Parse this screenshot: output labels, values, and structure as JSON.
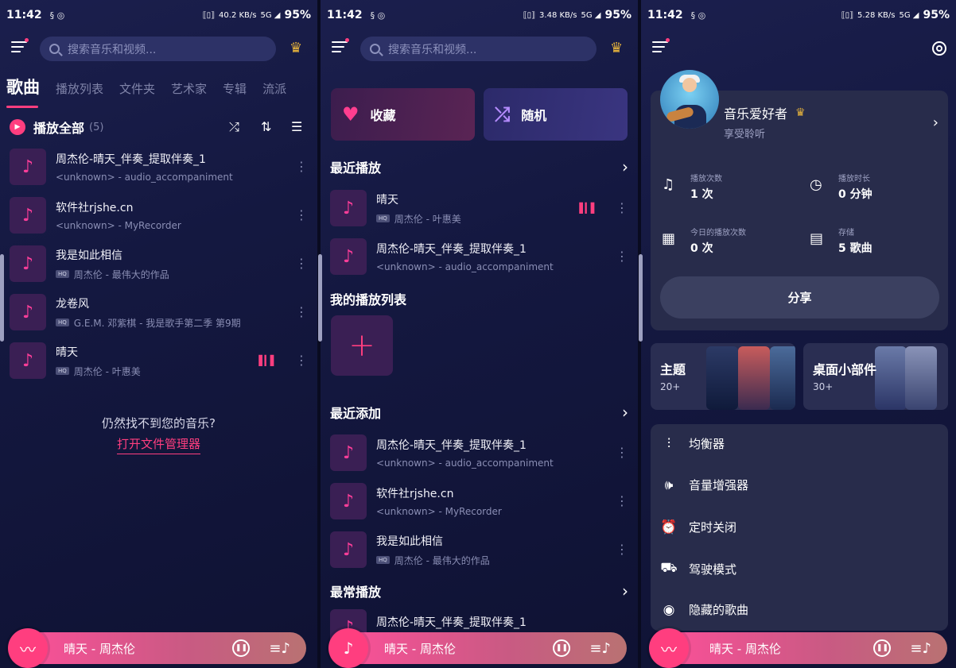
{
  "status_bars": [
    {
      "time": "11:42",
      "net": "40.2 KB/s",
      "battery": "95%"
    },
    {
      "time": "11:42",
      "net": "3.48 KB/s",
      "battery": "95%"
    },
    {
      "time": "11:42",
      "net": "5.28 KB/s",
      "battery": "95%"
    }
  ],
  "search_placeholder": "搜索音乐和视频...",
  "songs_screen": {
    "tabs": [
      "歌曲",
      "播放列表",
      "文件夹",
      "艺术家",
      "专辑",
      "流派"
    ],
    "play_all_label": "播放全部",
    "play_all_count": "(5)",
    "songs": [
      {
        "title": "周杰伦-晴天_伴奏_提取伴奏_1",
        "subtitle": "<unknown> - audio_accompaniment",
        "hq": false,
        "playing": false
      },
      {
        "title": "软件社rjshe.cn",
        "subtitle": "<unknown> - MyRecorder",
        "hq": false,
        "playing": false
      },
      {
        "title": "我是如此相信",
        "subtitle": "周杰伦 - 最伟大的作品",
        "hq": true,
        "playing": false
      },
      {
        "title": "龙卷风",
        "subtitle": "G.E.M. 邓紫棋 - 我是歌手第二季 第9期",
        "hq": true,
        "playing": false
      },
      {
        "title": "晴天",
        "subtitle": "周杰伦 - 叶惠美",
        "hq": true,
        "playing": true
      }
    ],
    "not_found_text": "仍然找不到您的音乐?",
    "open_file_manager": "打开文件管理器"
  },
  "home_screen": {
    "favorites_label": "收藏",
    "shuffle_label": "随机",
    "recent_played_title": "最近播放",
    "recent_played": [
      {
        "title": "晴天",
        "subtitle": "周杰伦 - 叶惠美",
        "hq": true,
        "playing": true
      },
      {
        "title": "周杰伦-晴天_伴奏_提取伴奏_1",
        "subtitle": "<unknown> - audio_accompaniment",
        "hq": false,
        "playing": false
      }
    ],
    "my_playlists_title": "我的播放列表",
    "recently_added_title": "最近添加",
    "recently_added": [
      {
        "title": "周杰伦-晴天_伴奏_提取伴奏_1",
        "subtitle": "<unknown> - audio_accompaniment",
        "hq": false
      },
      {
        "title": "软件社rjshe.cn",
        "subtitle": "<unknown> - MyRecorder",
        "hq": false
      },
      {
        "title": "我是如此相信",
        "subtitle": "周杰伦 - 最伟大的作品",
        "hq": true
      }
    ],
    "most_played_title": "最常播放",
    "most_played": [
      {
        "title": "周杰伦-晴天_伴奏_提取伴奏_1"
      }
    ]
  },
  "profile_screen": {
    "user_name": "音乐爱好者",
    "user_subtitle": "享受聆听",
    "stats": [
      {
        "label": "播放次数",
        "value": "1 次",
        "icon": "music-note-icon"
      },
      {
        "label": "播放时长",
        "value": "0 分钟",
        "icon": "clock-icon"
      },
      {
        "label": "今日的播放次数",
        "value": "0 次",
        "icon": "calendar-icon"
      },
      {
        "label": "存储",
        "value": "5 歌曲",
        "icon": "storage-icon"
      }
    ],
    "share_label": "分享",
    "theme_label": "主题",
    "theme_count": "20+",
    "widgets_label": "桌面小部件",
    "widgets_count": "30+",
    "settings": [
      {
        "label": "均衡器",
        "icon": "equalizer-icon"
      },
      {
        "label": "音量增强器",
        "icon": "volume-boost-icon"
      },
      {
        "label": "定时关闭",
        "icon": "alarm-icon"
      },
      {
        "label": "驾驶模式",
        "icon": "car-icon"
      },
      {
        "label": "隐藏的歌曲",
        "icon": "eye-hidden-icon"
      }
    ]
  },
  "now_playing": "晴天 - 周杰伦",
  "colors": {
    "accent": "#ff3e7f",
    "bg": "#141840",
    "card": "#282c4b"
  }
}
